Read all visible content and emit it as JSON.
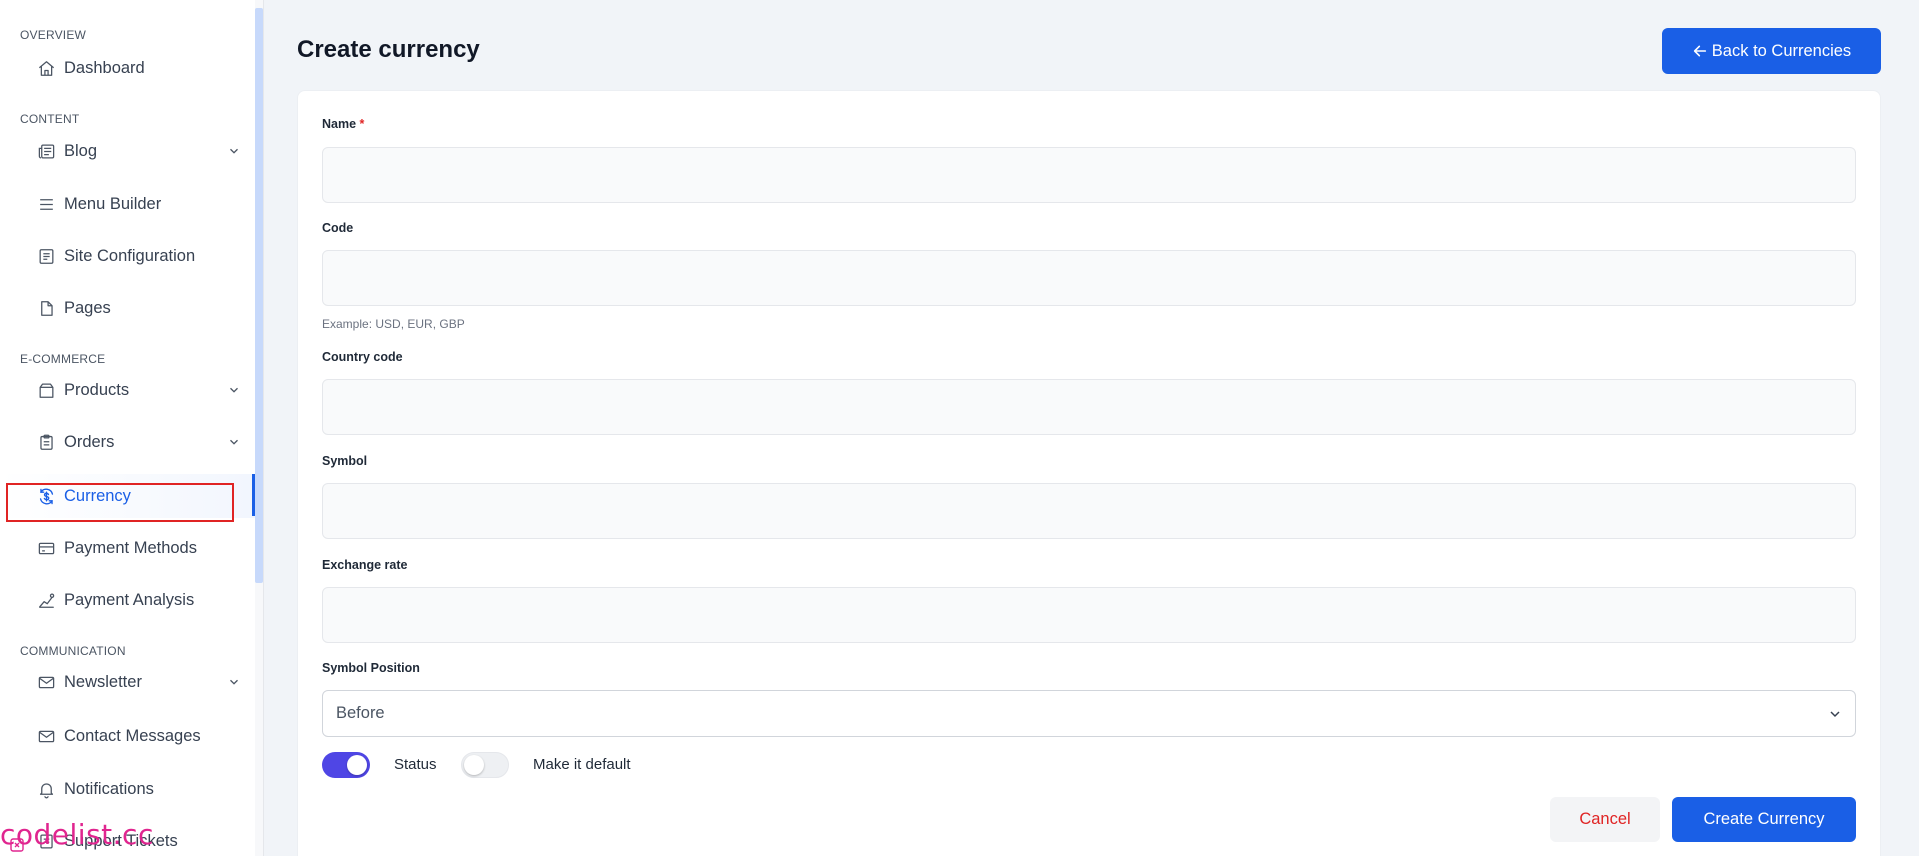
{
  "sidebar": {
    "sections": {
      "overview": "OVERVIEW",
      "content": "CONTENT",
      "ecommerce": "E-COMMERCE",
      "communication": "COMMUNICATION"
    },
    "items": {
      "dashboard": "Dashboard",
      "blog": "Blog",
      "menu_builder": "Menu Builder",
      "site_configuration": "Site Configuration",
      "pages": "Pages",
      "products": "Products",
      "orders": "Orders",
      "currency": "Currency",
      "payment_methods": "Payment Methods",
      "payment_analysis": "Payment Analysis",
      "newsletter": "Newsletter",
      "contact_messages": "Contact Messages",
      "notifications": "Notifications",
      "support_tickets": "Support Tickets"
    },
    "active_item": "Currency"
  },
  "watermark": "codelist.cc",
  "header": {
    "title": "Create currency",
    "back_label": "Back to Currencies"
  },
  "form": {
    "name": {
      "label": "Name",
      "required_mark": "*",
      "value": ""
    },
    "code": {
      "label": "Code",
      "value": "",
      "hint": "Example: USD, EUR, GBP"
    },
    "country_code": {
      "label": "Country code",
      "value": ""
    },
    "symbol": {
      "label": "Symbol",
      "value": ""
    },
    "exchange_rate": {
      "label": "Exchange rate",
      "value": ""
    },
    "symbol_position": {
      "label": "Symbol Position",
      "selected": "Before"
    },
    "status": {
      "label": "Status",
      "on": true
    },
    "make_default": {
      "label": "Make it default",
      "on": false
    },
    "cancel_label": "Cancel",
    "submit_label": "Create Currency"
  },
  "colors": {
    "primary": "#1a5fe6",
    "toggle_on": "#4f46e5",
    "danger": "#e02424",
    "watermark": "#e0258f"
  }
}
